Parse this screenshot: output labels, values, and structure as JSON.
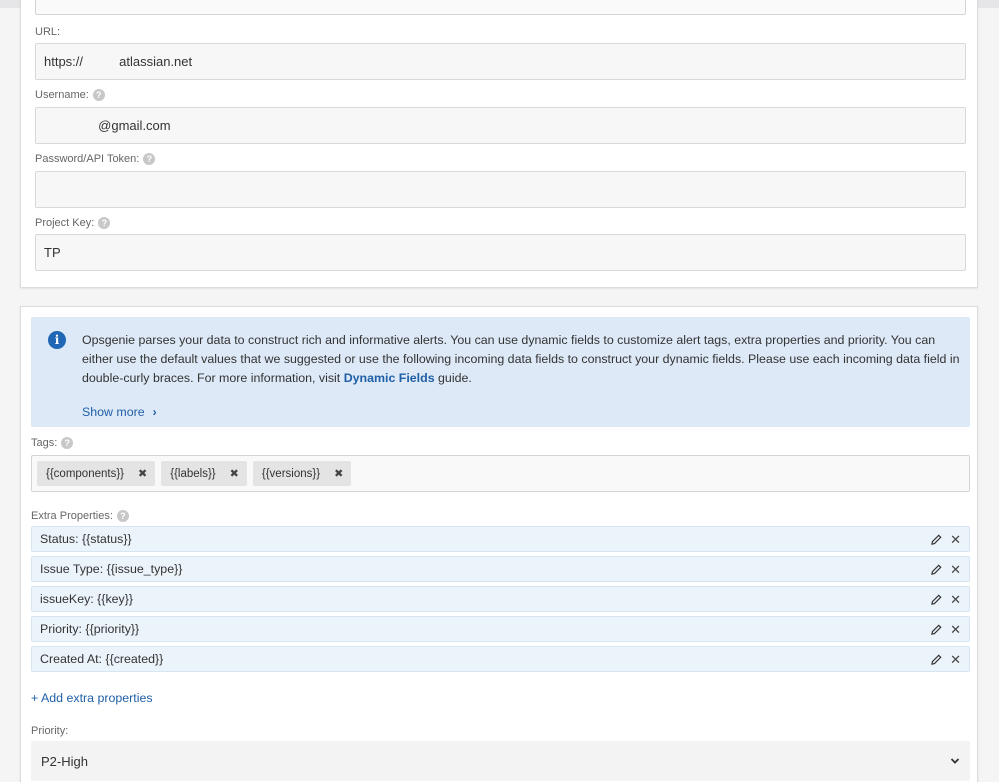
{
  "connection": {
    "url_label": "URL:",
    "url_value": "https://          atlassian.net",
    "username_label": "Username:",
    "username_value": "               @gmail.com",
    "password_label": "Password/API Token:",
    "password_value": "",
    "project_key_label": "Project Key:",
    "project_key_value": "TP"
  },
  "info": {
    "text_before_link": "Opsgenie parses your data to construct rich and informative alerts. You can use dynamic fields to customize alert tags, extra properties and priority. You can either use the default values that we suggested or use the following incoming data fields to construct your dynamic fields. Please use each incoming data field in double-curly braces. For more information, visit ",
    "link_text": "Dynamic Fields",
    "text_after_link": " guide.",
    "show_more": "Show more"
  },
  "tags": {
    "label": "Tags:",
    "items": [
      "{{components}}",
      "{{labels}}",
      "{{versions}}"
    ]
  },
  "extra_properties": {
    "label": "Extra Properties:",
    "items": [
      "Status: {{status}}",
      "Issue Type: {{issue_type}}",
      "issueKey: {{key}}",
      "Priority: {{priority}}",
      "Created At: {{created}}"
    ],
    "add_label": "+ Add extra properties"
  },
  "priority": {
    "label": "Priority:",
    "selected": "P2-High"
  },
  "help_glyph": "?",
  "info_glyph": "i",
  "remove_glyph": "✖",
  "close_glyph": "✕",
  "chevron_right_glyph": "›",
  "colors": {
    "accent": "#1f5fa6",
    "info_bg": "#dde9f7",
    "prop_bg": "#ebf3fb"
  }
}
